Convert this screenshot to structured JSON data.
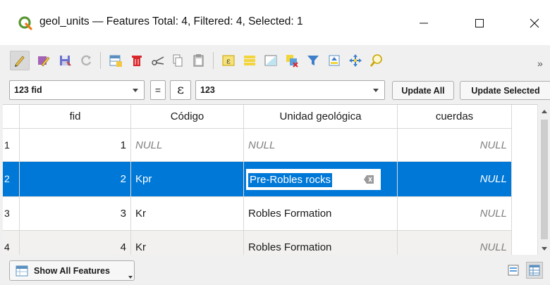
{
  "window": {
    "title": "geol_units — Features Total: 4, Filtered: 4, Selected: 1",
    "app_icon": "qgis-logo-icon",
    "controls": {
      "minimize": "minimize-icon",
      "maximize": "maximize-icon",
      "close": "close-icon"
    }
  },
  "toolbar": {
    "buttons": [
      {
        "name": "toggle-editing-icon",
        "active": true
      },
      {
        "name": "toggle-multi-edit-icon"
      },
      {
        "name": "save-edits-icon"
      },
      {
        "name": "reload-table-icon"
      },
      {
        "name": "add-feature-icon"
      },
      {
        "name": "delete-selected-icon"
      },
      {
        "name": "cut-icon"
      },
      {
        "name": "copy-icon"
      },
      {
        "name": "paste-icon"
      },
      {
        "name": "select-by-expression-icon"
      },
      {
        "name": "select-all-icon"
      },
      {
        "name": "invert-selection-icon"
      },
      {
        "name": "deselect-all-icon"
      },
      {
        "name": "filter-select-icon"
      },
      {
        "name": "move-selection-top-icon"
      },
      {
        "name": "pan-to-selected-icon"
      },
      {
        "name": "zoom-to-selected-icon"
      }
    ],
    "overflow_label": "»"
  },
  "field_calc": {
    "field_value": "123 fid",
    "equals": "=",
    "expression_symbol": "ε",
    "expression_value": "123",
    "update_all": "Update All",
    "update_selected": "Update Selected"
  },
  "table": {
    "headers": [
      "fid",
      "Código",
      "Unidad geológica",
      "cuerdas"
    ],
    "rows": [
      {
        "num": "1",
        "fid": "1",
        "codigo": "NULL",
        "unidad": "NULL",
        "cuerdas": "NULL"
      },
      {
        "num": "2",
        "fid": "2",
        "codigo": "Kpr",
        "unidad": "Pre-Robles rocks",
        "cuerdas": "NULL"
      },
      {
        "num": "3",
        "fid": "3",
        "codigo": "Kr",
        "unidad": "Robles Formation",
        "cuerdas": "NULL"
      },
      {
        "num": "4",
        "fid": "4",
        "codigo": "Kr",
        "unidad": "Robles Formation",
        "cuerdas": "NULL"
      }
    ],
    "selected_row": "2"
  },
  "bottom": {
    "show_all": "Show All Features",
    "form_view_icon": "form-view-icon",
    "table_view_icon": "table-view-icon"
  },
  "colors": {
    "selection": "#0078d7",
    "null_text": "#808080"
  }
}
